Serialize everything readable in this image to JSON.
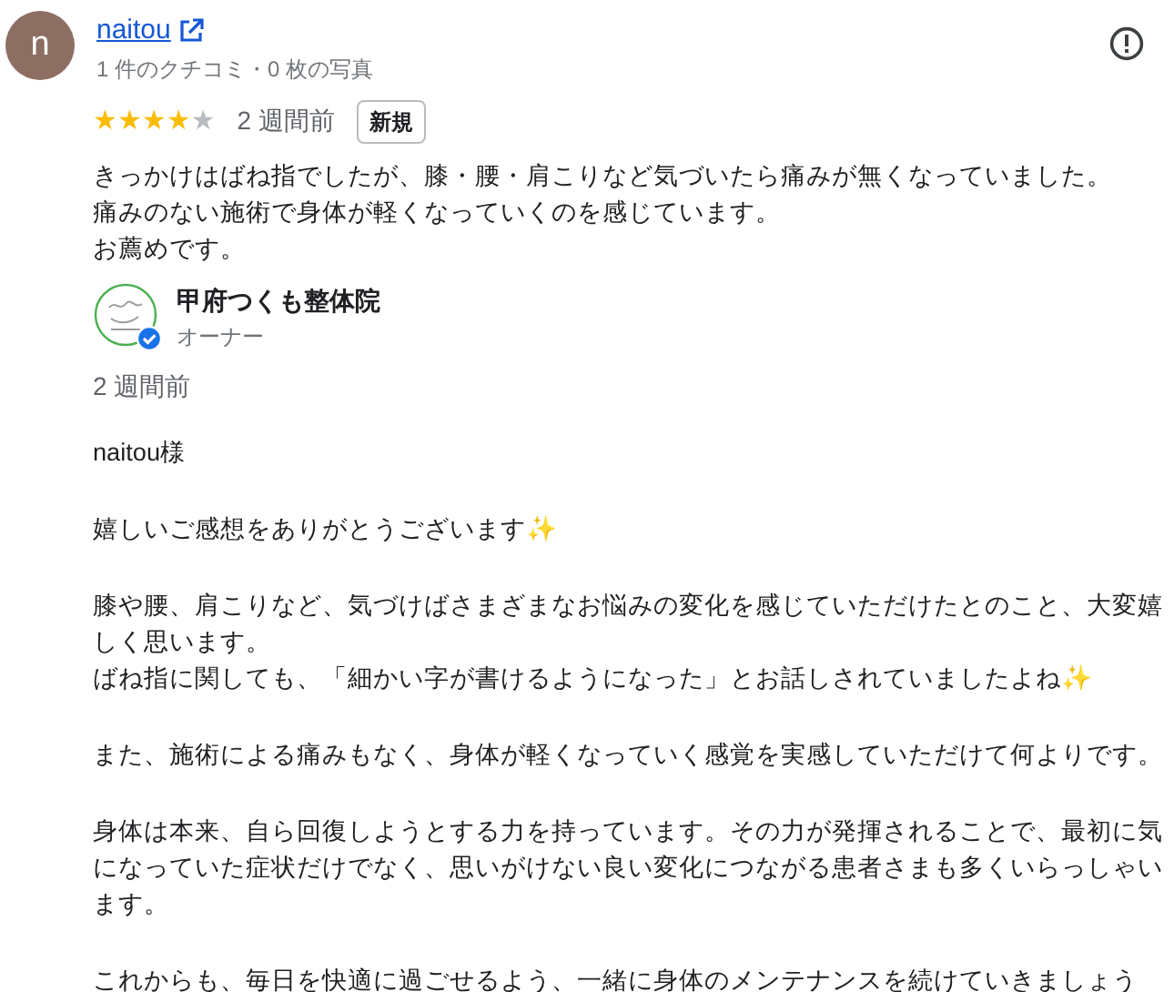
{
  "reviewer": {
    "initial": "n",
    "name": "naitou",
    "meta": "1 件のクチコミ・0 枚の写真"
  },
  "review": {
    "stars": 4,
    "time": "2 週間前",
    "badge": "新規",
    "lines": [
      "きっかけはばね指でしたが、膝・腰・肩こりなど気づいたら痛みが無くなっていました。",
      "痛みのない施術で身体が軽くなっていくのを感じています。",
      "お薦めです。"
    ]
  },
  "owner": {
    "name": "甲府つくも整体院",
    "role": "オーナー",
    "verified": true,
    "time": "2 週間前",
    "paragraphs": [
      "naitou様",
      "嬉しいご感想をありがとうございます✨",
      "膝や腰、肩こりなど、気づけばさまざまなお悩みの変化を感じていただけたとのこと、大変嬉しく思います。",
      "ばね指に関しても、「細かい字が書けるようになった」とお話しされていましたよね✨",
      "また、施術による痛みもなく、身体が軽くなっていく感覚を実感していただけて何よりです。",
      "身体は本来、自ら回復しようとする力を持っています。その力が発揮されることで、最初に気になっていた症状だけでなく、思いがけない良い変化につながる患者さまも多くいらっしゃいます。",
      "これからも、毎日を快適に過ごせるよう、一緒に身体のメンテナンスを続けていきましょう"
    ]
  }
}
